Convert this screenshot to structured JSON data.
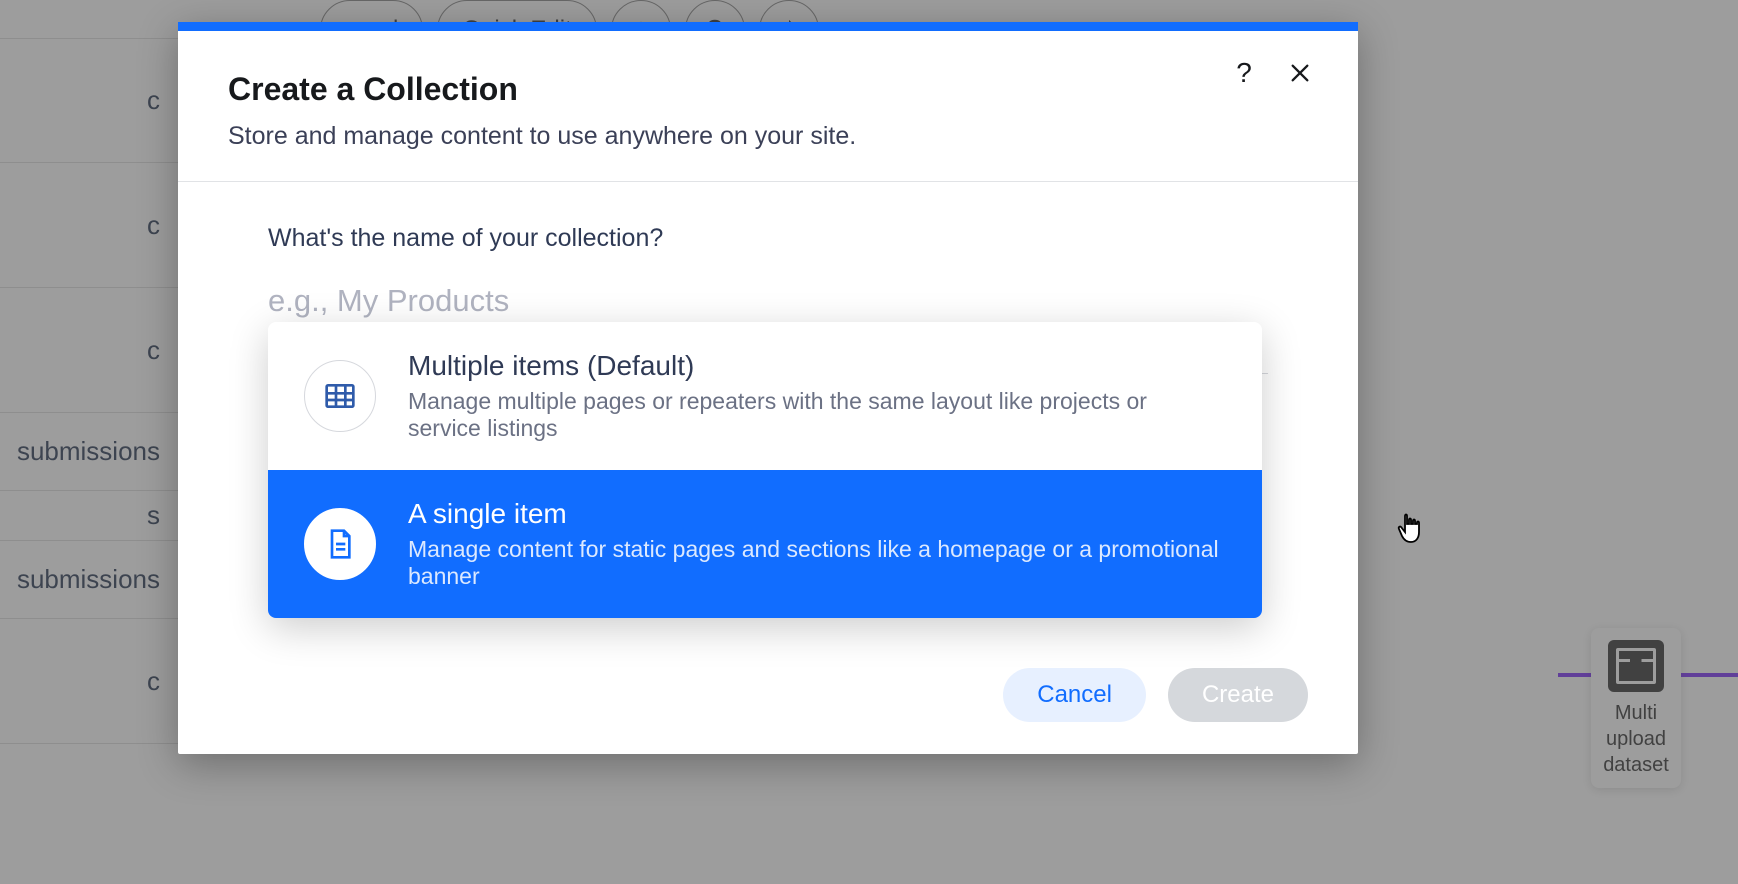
{
  "background": {
    "sidebar_items": [
      "c",
      "c",
      "c",
      "submissions",
      "s",
      "submissions",
      "c"
    ],
    "toolbar": {
      "label_1": "ound",
      "label_2": "Quick Edit"
    },
    "floating": {
      "label": "Multi upload dataset"
    }
  },
  "modal": {
    "title": "Create a Collection",
    "subtitle": "Store and manage content to use anywhere on your site.",
    "field_label": "What's the name of your collection?",
    "placeholder": "e.g., My Products",
    "options": [
      {
        "title": "Multiple items (Default)",
        "desc": "Manage multiple pages or repeaters with the same layout like projects or service listings"
      },
      {
        "title": "A single item",
        "desc": "Manage content for static pages and sections like a homepage or a promotional banner"
      }
    ],
    "cancel_label": "Cancel",
    "create_label": "Create"
  }
}
